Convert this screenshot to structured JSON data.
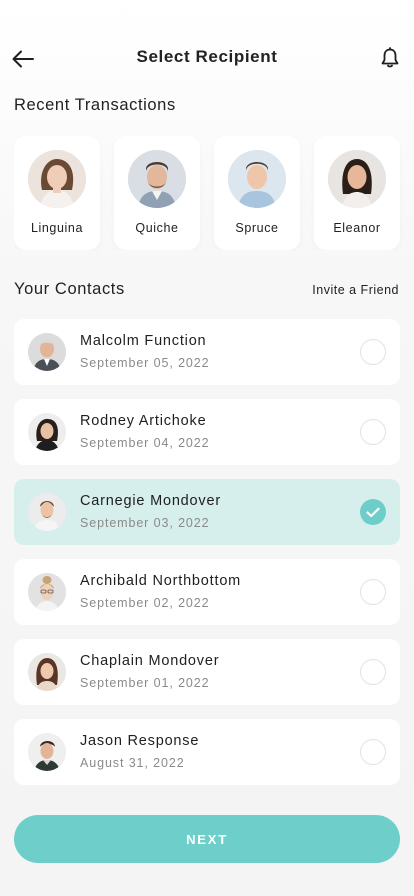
{
  "header": {
    "title": "Select Recipient",
    "back_icon": "arrow-left-icon",
    "bell_icon": "bell-icon"
  },
  "recent": {
    "title": "Recent Transactions",
    "items": [
      {
        "name": "Linguina"
      },
      {
        "name": "Quiche"
      },
      {
        "name": "Spruce"
      },
      {
        "name": "Eleanor"
      }
    ]
  },
  "contacts": {
    "title": "Your Contacts",
    "invite_label": "Invite a Friend",
    "items": [
      {
        "name": "Malcolm Function",
        "date": "September 05, 2022",
        "selected": false
      },
      {
        "name": "Rodney Artichoke",
        "date": "September 04, 2022",
        "selected": false
      },
      {
        "name": "Carnegie Mondover",
        "date": "September 03, 2022",
        "selected": true
      },
      {
        "name": "Archibald Northbottom",
        "date": "September 02, 2022",
        "selected": false
      },
      {
        "name": "Chaplain Mondover",
        "date": "September 01, 2022",
        "selected": false
      },
      {
        "name": "Jason Response",
        "date": "August 31, 2022",
        "selected": false
      }
    ]
  },
  "next_label": "NEXT",
  "colors": {
    "accent": "#6ecfca",
    "selected_row": "#d6efec",
    "muted_text": "#8a8a8a"
  }
}
